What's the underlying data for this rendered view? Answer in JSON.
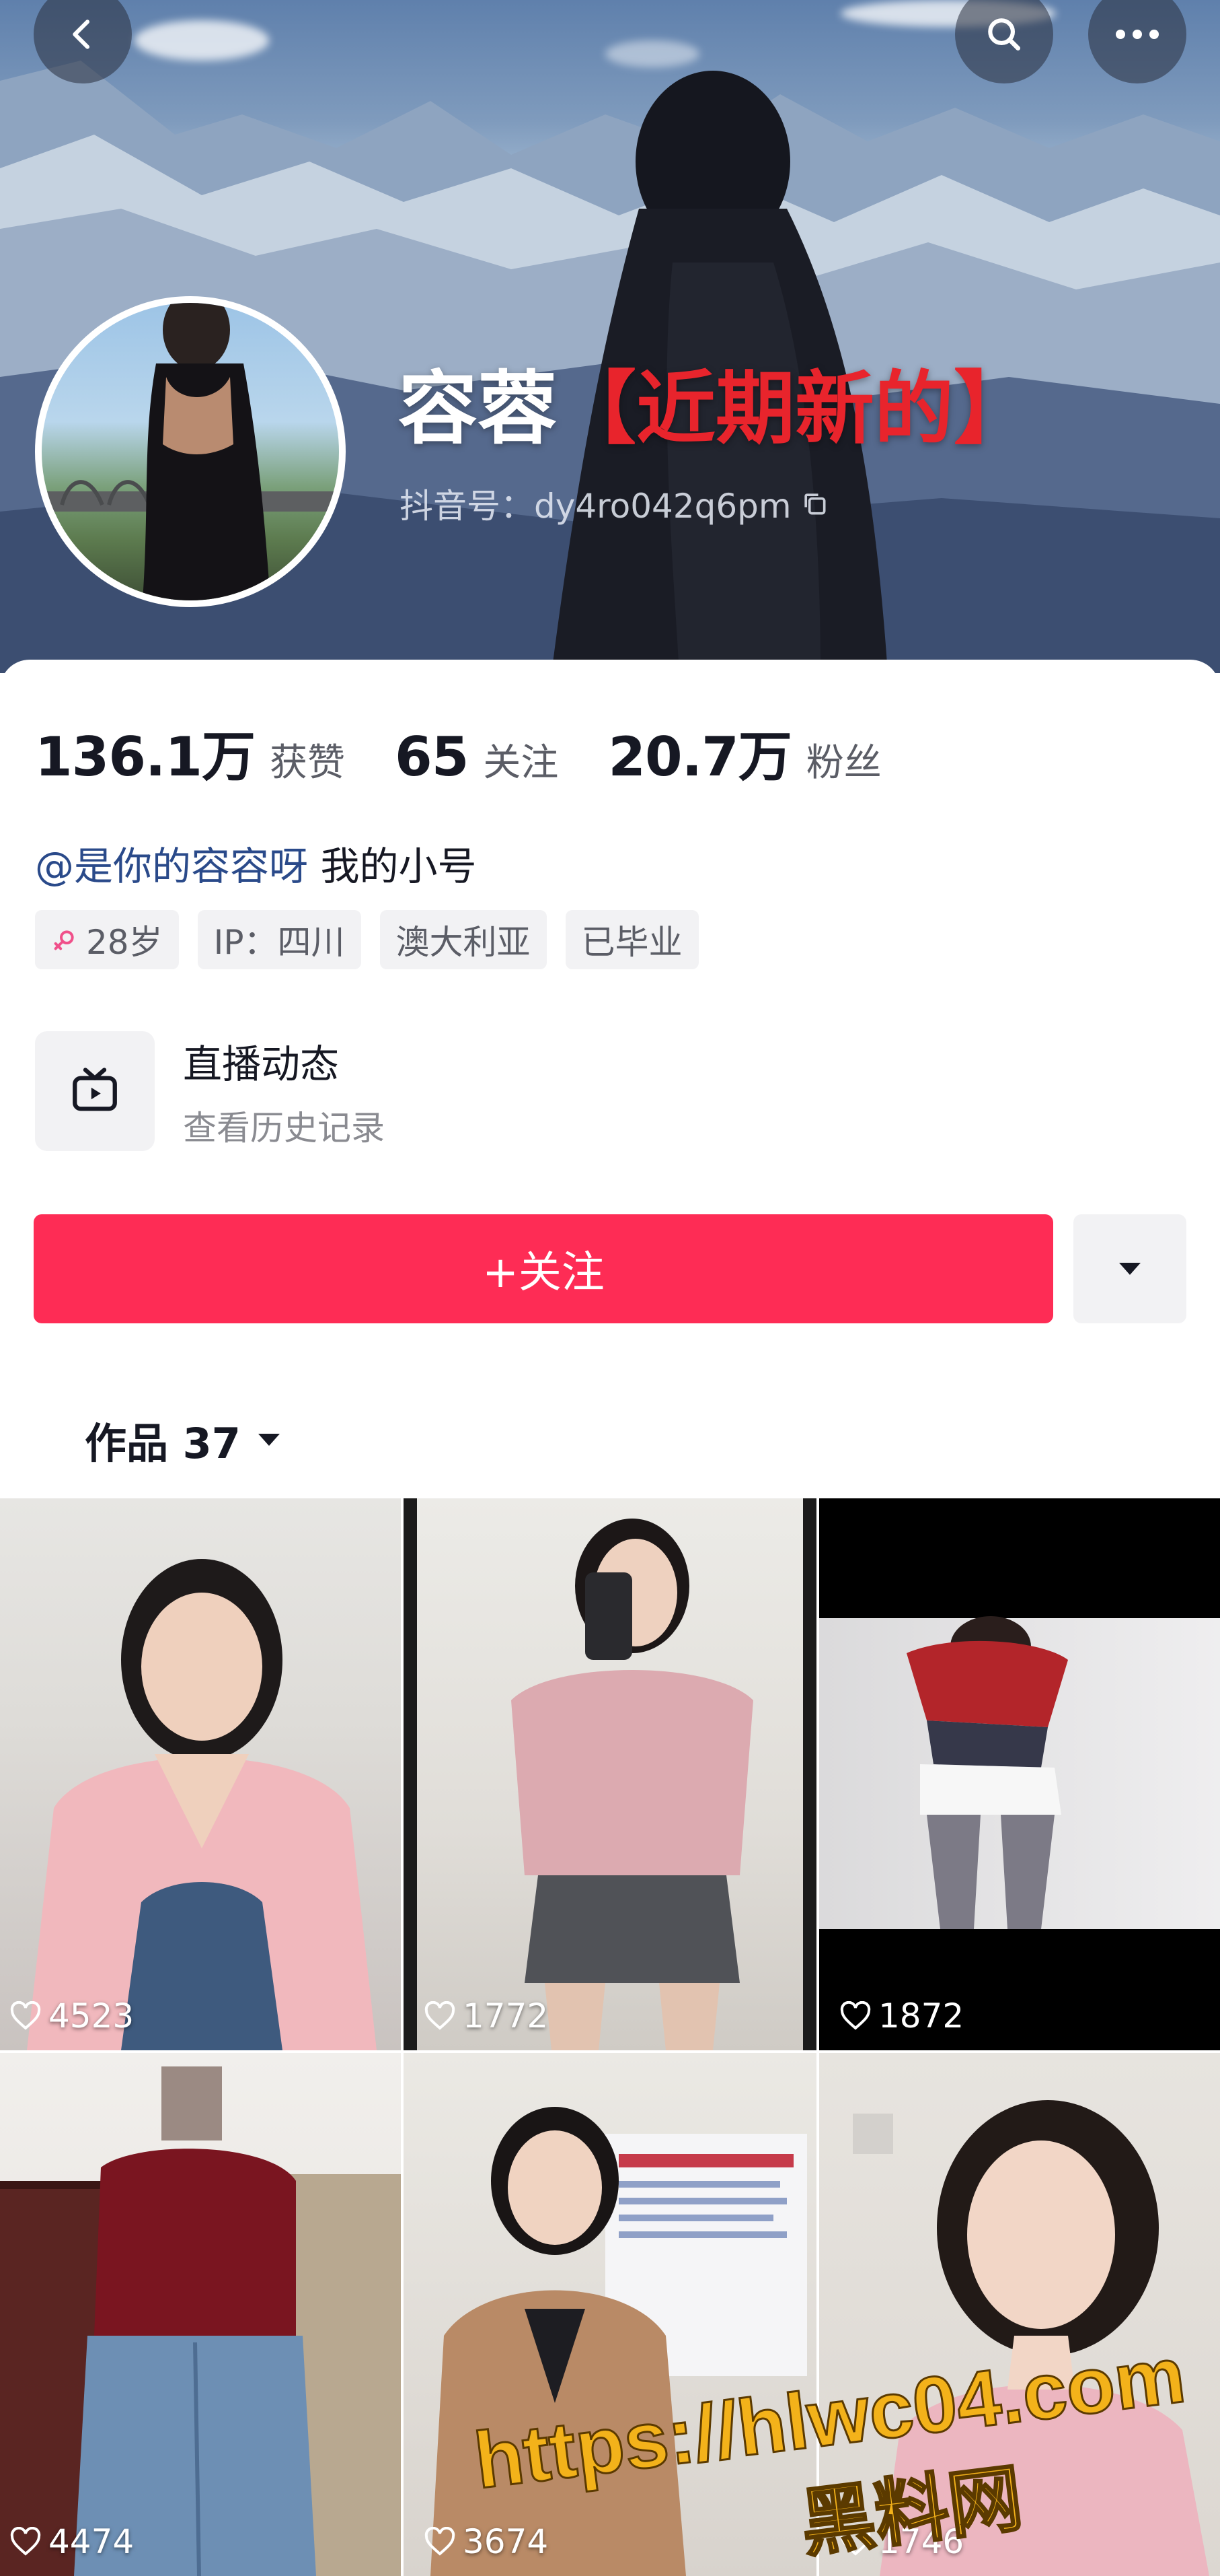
{
  "profile": {
    "name": "容蓉",
    "name_suffix": "【近期新的】",
    "douyin_id": "抖音号：dy4ro042q6pm"
  },
  "stats": [
    {
      "value": "136.1万",
      "label": "获赞"
    },
    {
      "value": "65",
      "label": "关注"
    },
    {
      "value": "20.7万",
      "label": "粉丝"
    }
  ],
  "bio": {
    "mention": "@是你的容容呀",
    "text": " 我的小号"
  },
  "tags": [
    {
      "icon": "female-icon",
      "label": "28岁"
    },
    {
      "label": "IP：四川"
    },
    {
      "label": "澳大利亚"
    },
    {
      "label": "已毕业"
    }
  ],
  "live": {
    "title": "直播动态",
    "subtitle": "查看历史记录"
  },
  "follow_button": "+关注",
  "works_tab": {
    "label": "作品 37"
  },
  "videos": [
    {
      "likes": "4523"
    },
    {
      "likes": "1772"
    },
    {
      "likes": "1872"
    },
    {
      "likes": "4474"
    },
    {
      "likes": "3674"
    },
    {
      "likes": "1746"
    }
  ],
  "watermark": {
    "url": "https://hlwc04.com",
    "site": "黑料网"
  },
  "colors": {
    "follow": "#fe2c55",
    "name_red": "#e8242c",
    "mention": "#2a4a8a"
  }
}
